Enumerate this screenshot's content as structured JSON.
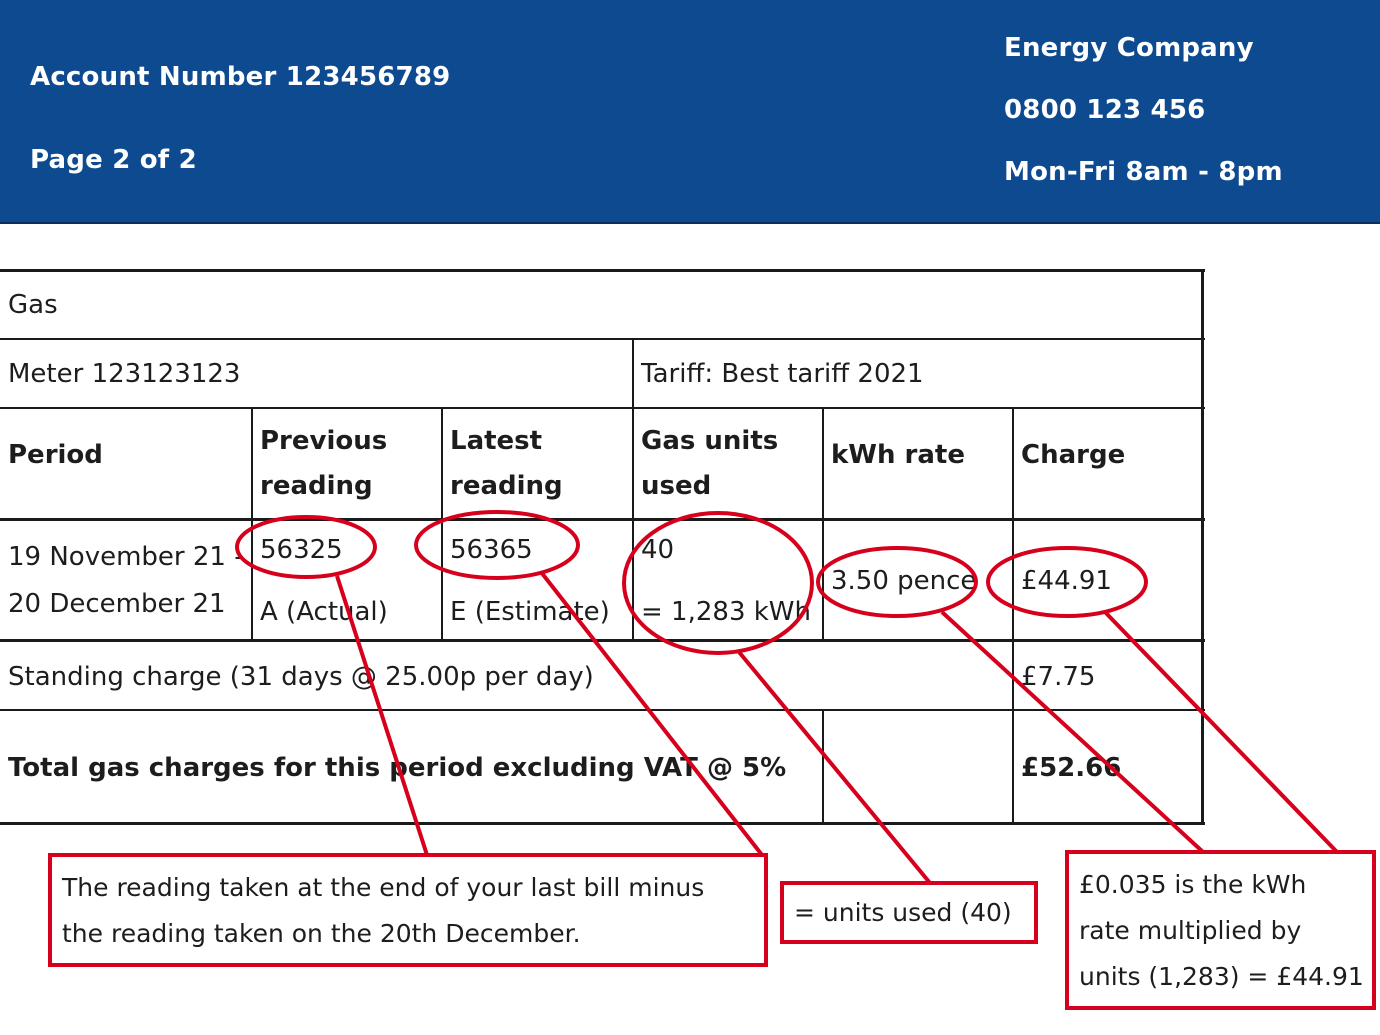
{
  "header": {
    "account_number": "Account Number 123456789",
    "page": "Page 2 of 2",
    "company": "Energy Company",
    "phone": "0800 123 456",
    "hours": "Mon-Fri 8am - 8pm"
  },
  "gas_table": {
    "section_title": "Gas",
    "meter": "Meter 123123123",
    "tariff": "Tariff: Best tariff 2021",
    "columns": {
      "period": "Period",
      "previous_reading": [
        "Previous",
        "reading"
      ],
      "latest_reading": [
        "Latest",
        "reading"
      ],
      "gas_units_used": [
        "Gas units",
        "used"
      ],
      "kwh_rate": "kWh rate",
      "charge": "Charge"
    },
    "row": {
      "period": [
        "19 November 21 -",
        "20 December 21"
      ],
      "previous_reading": "56325",
      "previous_type": "A (Actual)",
      "latest_reading": "56365",
      "latest_type": "E (Estimate)",
      "units": "40",
      "kwh": "= 1,283 kWh",
      "rate": "3.50 pence",
      "charge": "£44.91"
    },
    "standing_charge": {
      "label": "Standing charge (31 days @ 25.00p per day)",
      "amount": "£7.75"
    },
    "total": {
      "label": "Total gas charges for this period excluding VAT @ 5%",
      "amount": "£52.66"
    }
  },
  "annotations": {
    "reading_note": [
      "The reading taken at the end of your last bill minus",
      "the reading taken on the 20th December."
    ],
    "units_note": "= units used (40)",
    "rate_note": [
      "£0.035 is the kWh",
      "rate multiplied by",
      "units (1,283) = £44.91"
    ],
    "color": "#d6001c"
  },
  "colors": {
    "header_background": "#0e4a8f",
    "header_text": "#ffffff"
  }
}
